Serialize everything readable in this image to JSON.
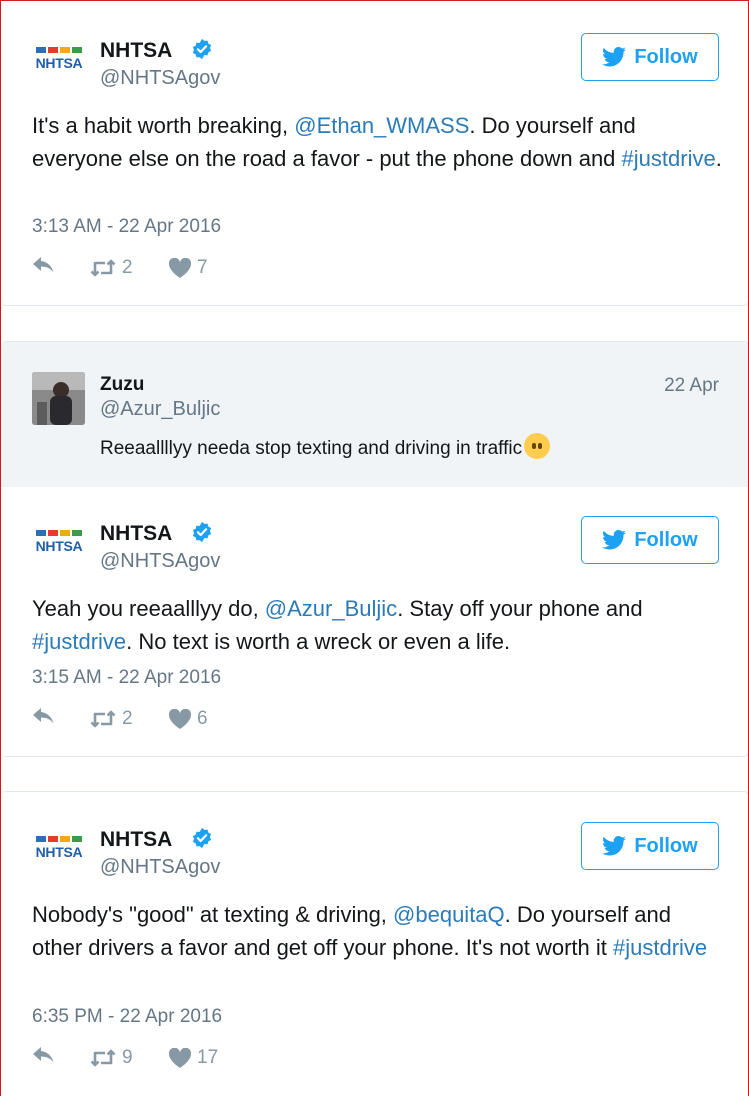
{
  "colors": {
    "brand_blue": "#1da1f2",
    "link": "#2b7bb9",
    "muted": "#657786",
    "verified": "#1da1f2"
  },
  "tweets": [
    {
      "author": {
        "name": "NHTSA",
        "handle": "@NHTSAgov",
        "verified": true,
        "logo_text": "NHTSA"
      },
      "follow_label": "Follow",
      "text_before": "It's a habit worth breaking, ",
      "mention": "@Ethan_WMASS",
      "text_middle": ". Do yourself and everyone else on the road a favor - put the phone down and ",
      "hashtag": "#justdrive",
      "text_after": ".",
      "timestamp": "3:13 AM - 22 Apr 2016",
      "retweets": "2",
      "likes": "7"
    },
    {
      "quoted": {
        "name": "Zuzu",
        "handle": "@Azur_Buljic",
        "date": "22 Apr",
        "text": "Reeaallllyy needa stop texting and driving in traffic"
      },
      "author": {
        "name": "NHTSA",
        "handle": "@NHTSAgov",
        "verified": true,
        "logo_text": "NHTSA"
      },
      "follow_label": "Follow",
      "text_before": "Yeah you reeaalllyy do, ",
      "mention": "@Azur_Buljic",
      "text_middle": ". Stay off your phone and ",
      "hashtag": "#justdrive",
      "text_after": ". No text is worth a wreck or even a life.",
      "timestamp": "3:15 AM - 22 Apr 2016",
      "retweets": "2",
      "likes": "6"
    },
    {
      "author": {
        "name": "NHTSA",
        "handle": "@NHTSAgov",
        "verified": true,
        "logo_text": "NHTSA"
      },
      "follow_label": "Follow",
      "text_before": "Nobody's \"good\" at texting & driving, ",
      "mention": "@bequitaQ",
      "text_middle": ". Do yourself and other drivers a favor and get off your phone. It's not worth it ",
      "hashtag": "#justdrive",
      "text_after": "",
      "timestamp": "6:35 PM - 22 Apr 2016",
      "retweets": "9",
      "likes": "17"
    }
  ]
}
